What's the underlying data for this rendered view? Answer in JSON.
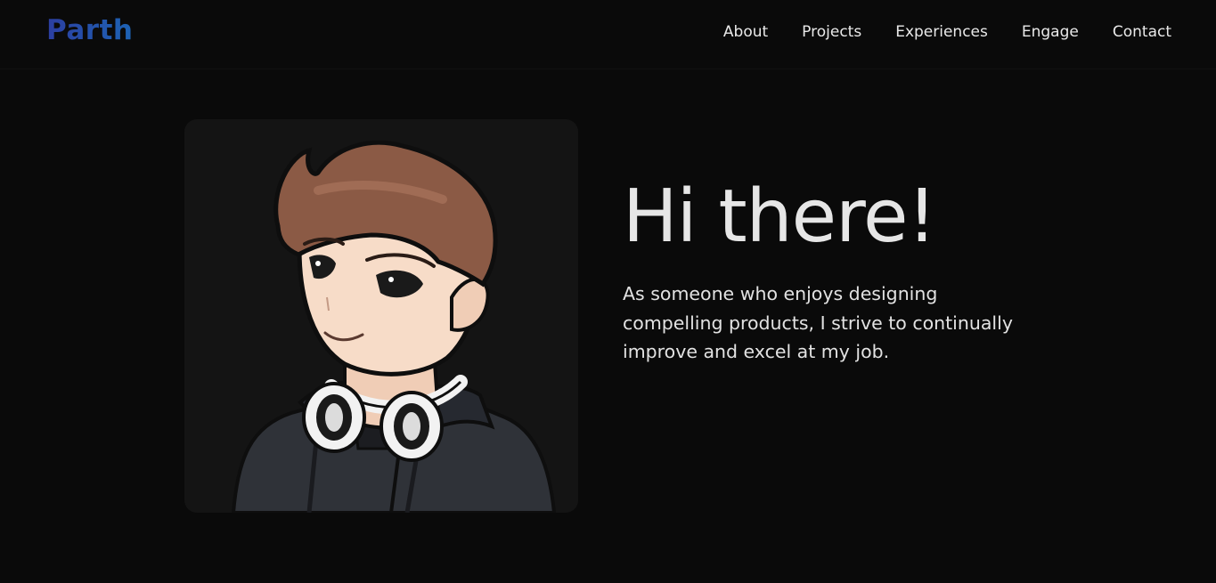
{
  "nav": {
    "logo": "Parth",
    "links": [
      {
        "label": "About"
      },
      {
        "label": "Projects"
      },
      {
        "label": "Experiences"
      },
      {
        "label": "Engage"
      },
      {
        "label": "Contact"
      }
    ]
  },
  "hero": {
    "title": "Hi there!",
    "description": "As someone who enjoys designing compelling products, I strive to continually improve and excel at my job.",
    "avatar": "cartoon avatar with headphones"
  },
  "colors": {
    "background": "#0a0a0a",
    "card": "#141414",
    "logo_gradient_start": "#2c3ea0",
    "logo_gradient_end": "#1d63b4",
    "text": "#e6e6e6"
  }
}
